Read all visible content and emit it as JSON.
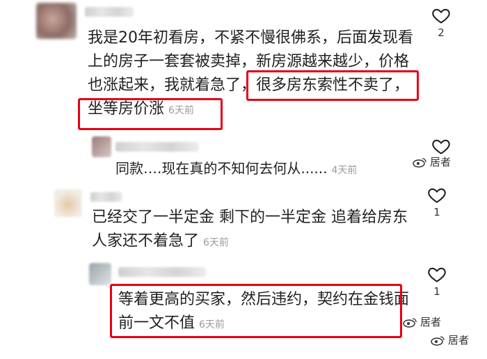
{
  "comments": [
    {
      "lines": [
        "我是20年初看房，不紧不慢很佛系，后面发现看",
        "上的房子一套套被卖掉，新房源越来越少，价格",
        "也涨起来，我就着急了，很多房东索性不卖了，"
      ],
      "last_line": "坐等房价涨",
      "time": "6天前",
      "likes": "2"
    },
    {
      "text": "同款….现在真的不知何去何从......",
      "time": "4天前",
      "likes": ""
    },
    {
      "line1": "已经交了一半定金 剩下的一半定金 追着给房东",
      "line2": "人家还不着急了",
      "time": "6天前",
      "likes": "1"
    },
    {
      "line1": "等着更高的买家，然后违约，契约在金钱面",
      "line2": "前一文不值",
      "time": "6天前",
      "likes": "1"
    }
  ],
  "watermark": {
    "label": "居者",
    "icon": "weibo-logo-icon"
  },
  "colors": {
    "highlight": "#e60012",
    "timestamp": "#9a9a9a"
  }
}
